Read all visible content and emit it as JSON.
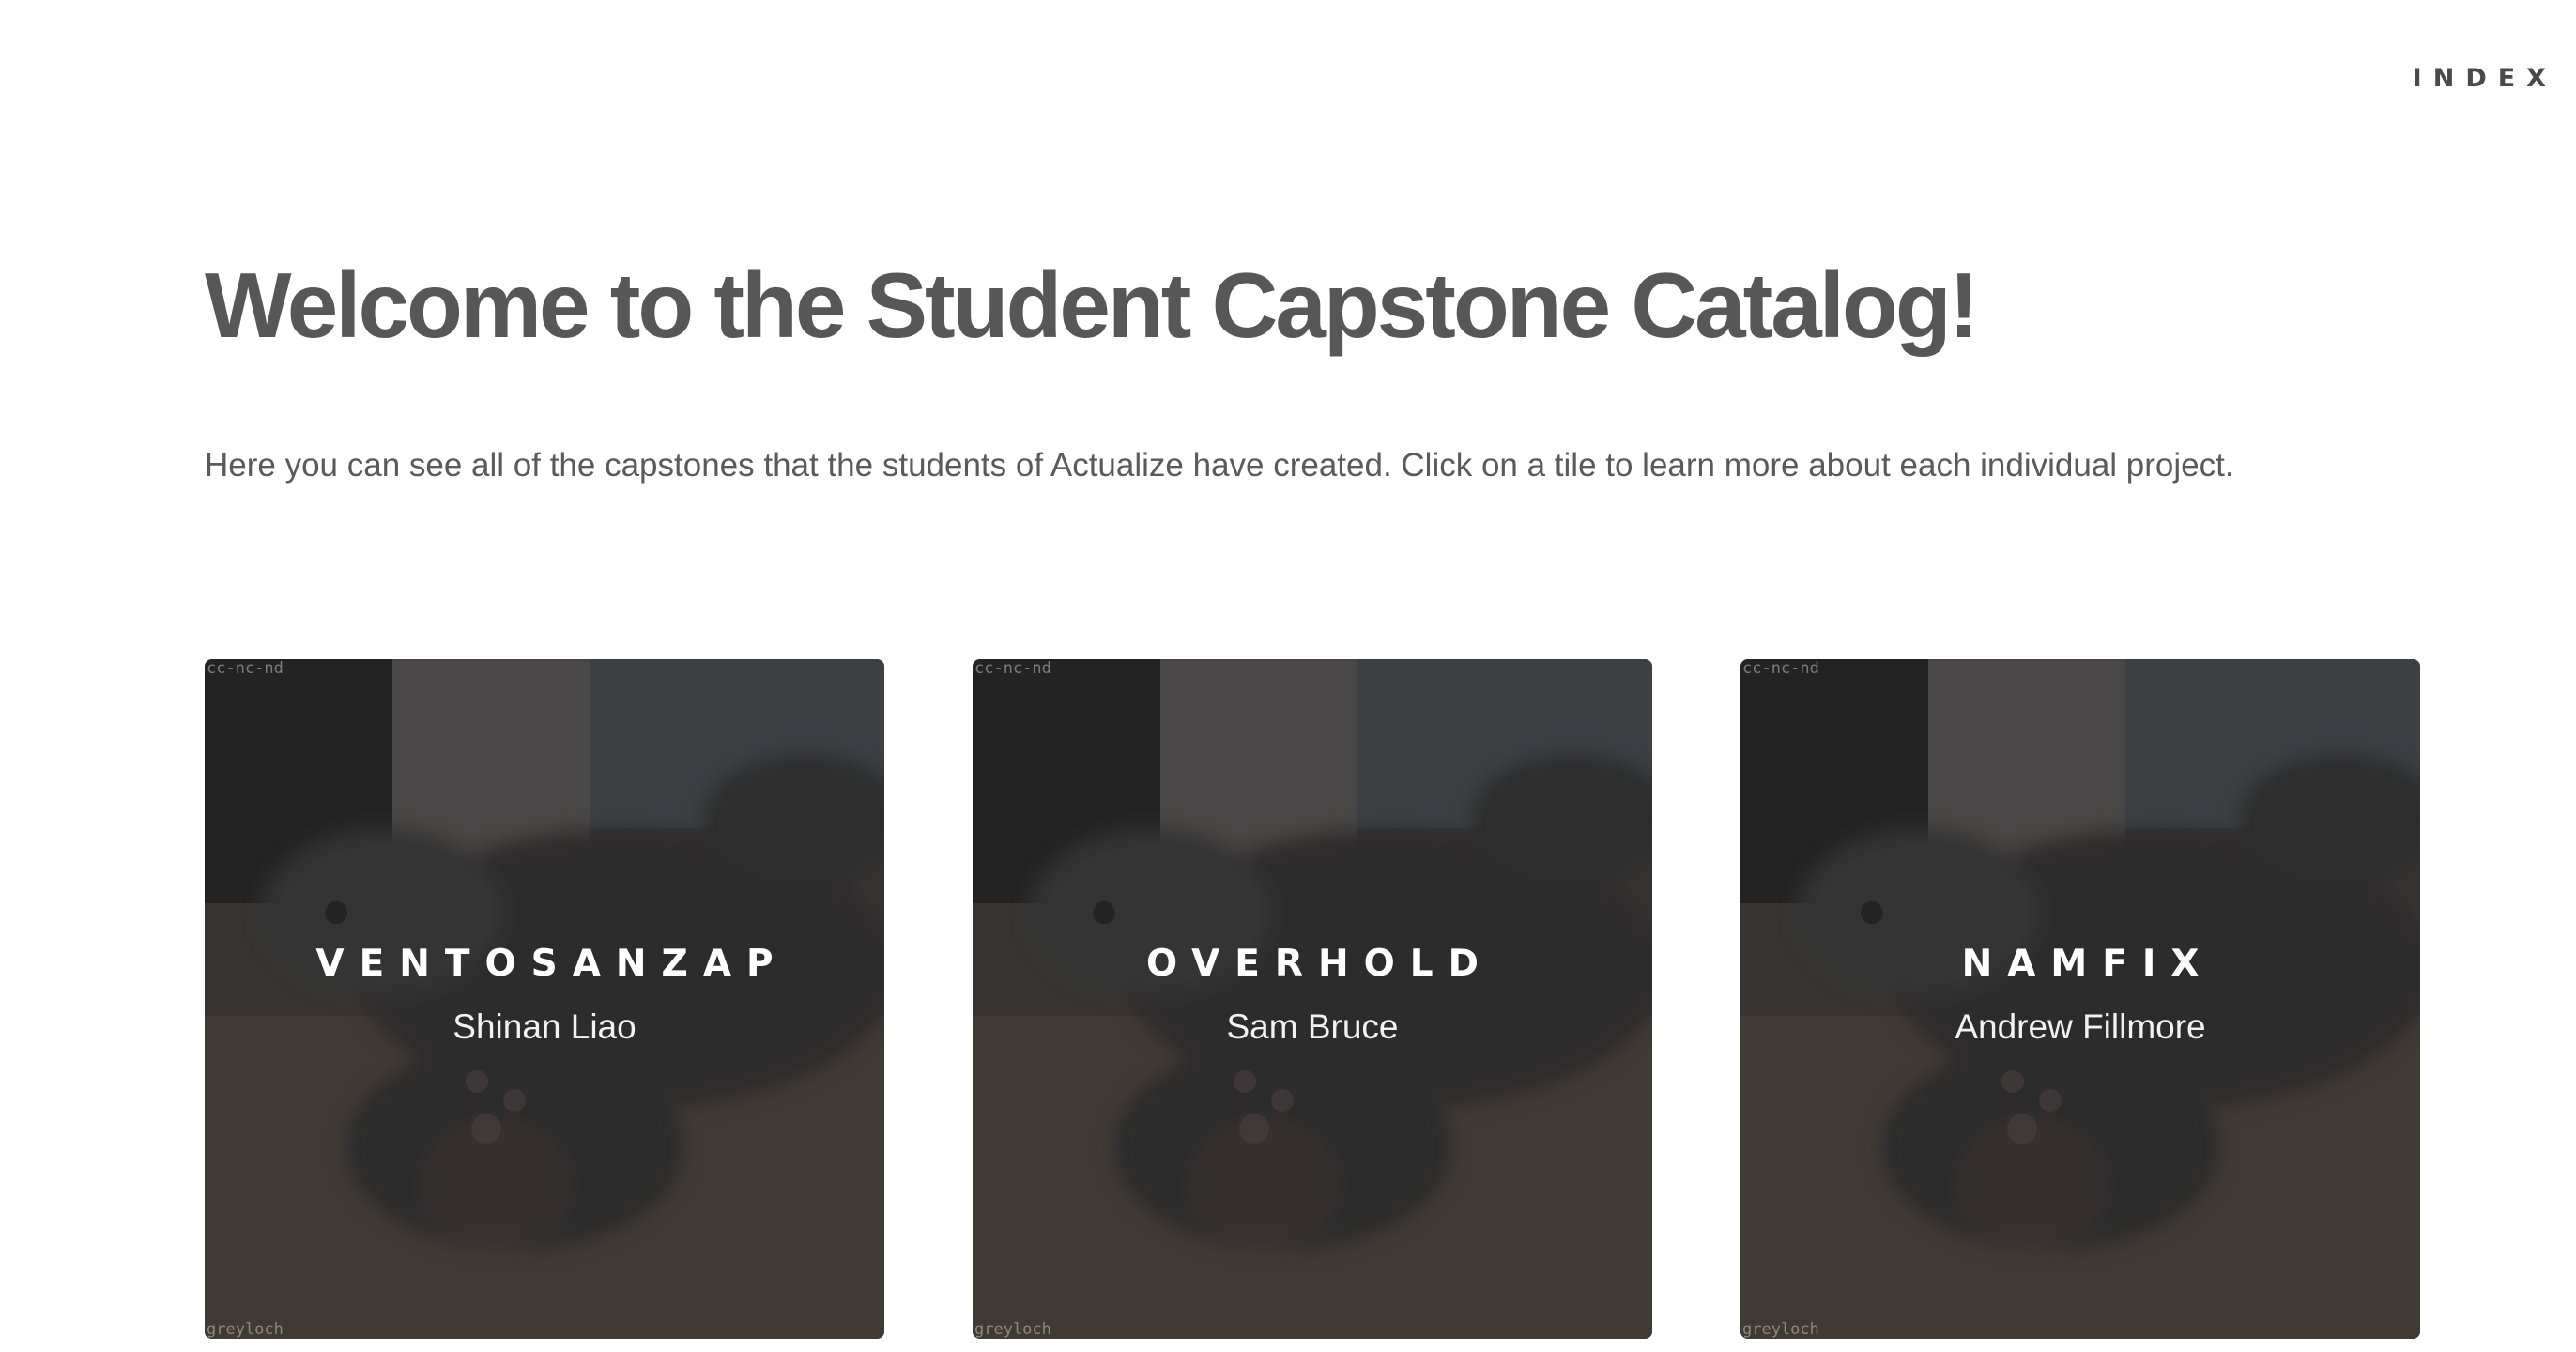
{
  "nav": {
    "index_label": "INDEX"
  },
  "header": {
    "title": "Welcome to the Student Capstone Catalog!",
    "intro": "Here you can see all of the capstones that the students of Actualize have created. Click on a tile to learn more about each individual project."
  },
  "tiles": [
    {
      "project": "VENTOSANZAP",
      "student": "Shinan Liao",
      "watermark_top": "cc-nc-nd",
      "watermark_bottom": "greyloch"
    },
    {
      "project": "OVERHOLD",
      "student": "Sam Bruce",
      "watermark_top": "cc-nc-nd",
      "watermark_bottom": "greyloch"
    },
    {
      "project": "NAMFIX",
      "student": "Andrew Fillmore",
      "watermark_top": "cc-nc-nd",
      "watermark_bottom": "greyloch"
    }
  ],
  "colors": {
    "heading": "#575757",
    "text": "#5a5a5a",
    "tile_overlay": "#2a2a2a"
  }
}
